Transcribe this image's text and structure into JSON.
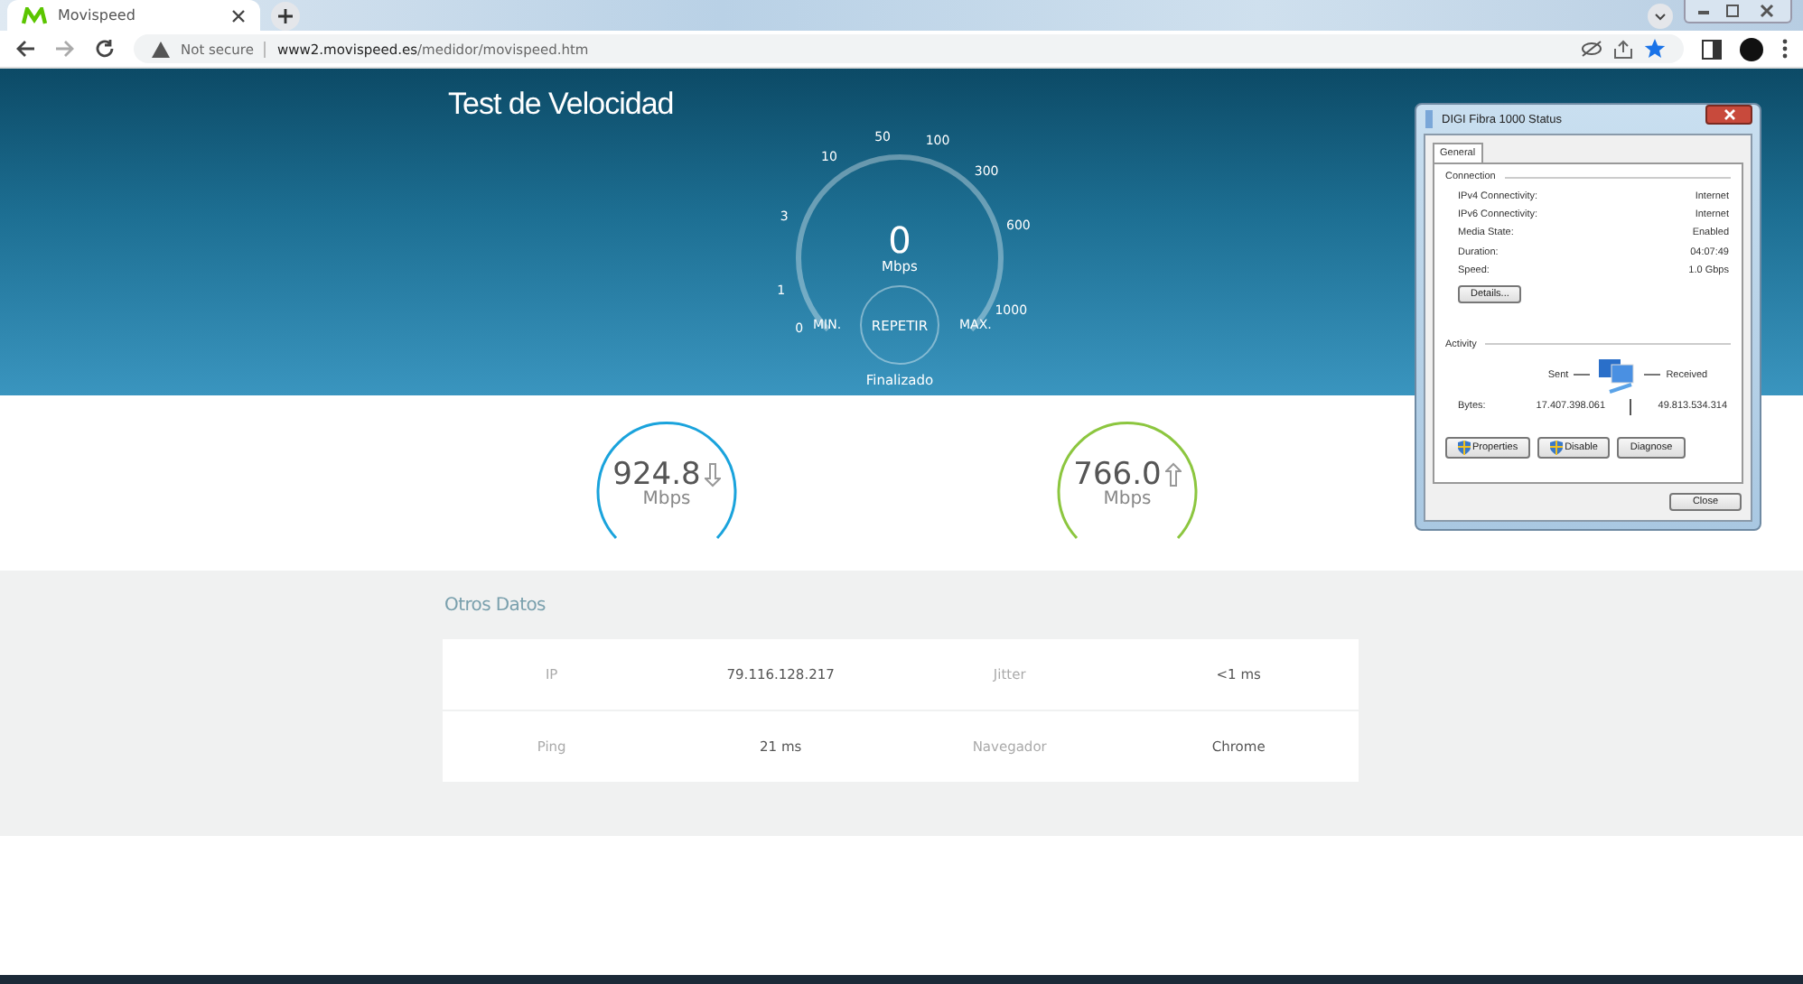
{
  "browser": {
    "tabs": [
      {
        "title": "Movispeed",
        "selected": true
      }
    ],
    "security": "Not secure",
    "url_host": "www2.movispeed.es",
    "url_path": "/medidor/movispeed.htm"
  },
  "hero": {
    "title": "Test de Velocidad",
    "gauge": {
      "ticks": [
        "0",
        "1",
        "3",
        "10",
        "50",
        "100",
        "300",
        "600",
        "1000"
      ],
      "value": "0",
      "unit": "Mbps",
      "min": "MIN.",
      "max": "MAX.",
      "button": "REPETIR",
      "status": "Finalizado"
    }
  },
  "results": [
    {
      "kind": "download",
      "value": "924.8",
      "unit": "Mbps",
      "color": "#1aa3dc"
    },
    {
      "kind": "upload",
      "value": "766.0",
      "unit": "Mbps",
      "color": "#8cc63f"
    }
  ],
  "otros": {
    "title": "Otros Datos",
    "rows": [
      [
        {
          "label": "IP",
          "value": "79.116.128.217"
        },
        {
          "label": "Jitter",
          "value": "<1 ms"
        }
      ],
      [
        {
          "label": "Ping",
          "value": "21 ms"
        },
        {
          "label": "Navegador",
          "value": "Chrome"
        }
      ]
    ]
  },
  "dialog": {
    "title": "DIGI Fibra 1000 Status",
    "tabs": [
      {
        "label": "General",
        "selected": true
      }
    ],
    "connection_title": "Connection",
    "connection": [
      {
        "label": "IPv4 Connectivity:",
        "value": "Internet"
      },
      {
        "label": "IPv6 Connectivity:",
        "value": "Internet"
      },
      {
        "label": "Media State:",
        "value": "Enabled"
      },
      {
        "label": "Duration:",
        "value": "04:07:49"
      },
      {
        "label": "Speed:",
        "value": "1.0 Gbps"
      }
    ],
    "details_button": "Details...",
    "activity_title": "Activity",
    "sent": "Sent",
    "received": "Received",
    "bytes_label": "Bytes:",
    "bytes_sent": "17.407.398.061",
    "bytes_received": "49.813.534.314",
    "buttons": [
      {
        "label": "Properties",
        "shield": true
      },
      {
        "label": "Disable",
        "shield": true
      },
      {
        "label": "Diagnose",
        "shield": false
      }
    ],
    "close": "Close"
  }
}
